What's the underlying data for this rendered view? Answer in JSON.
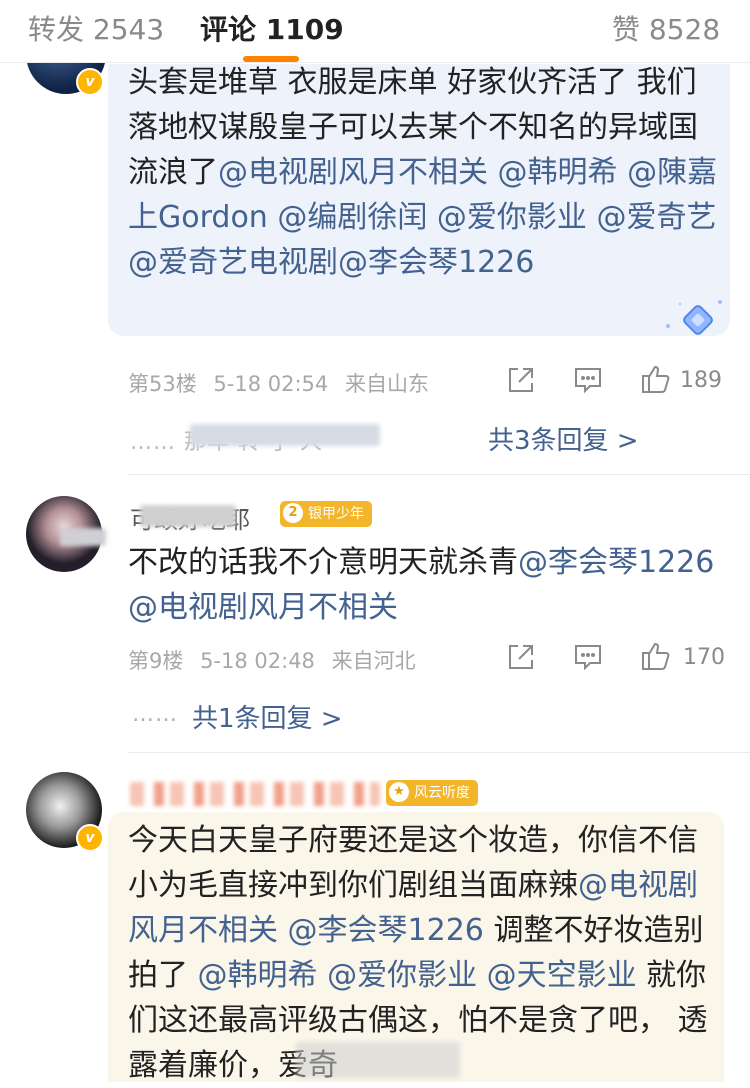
{
  "tabs": {
    "repost": "转发 2543",
    "comments": "评论 1109",
    "likes": "赞 8528"
  },
  "comment1": {
    "segments": [
      {
        "text": "头套是堆草 衣服是床单 好家伙齐活了 我们落地权谋殷皇子可以去某个不知名的异域国流浪了",
        "mention": false
      },
      {
        "text": "@电视剧风月不相关",
        "mention": true
      },
      {
        "text": " ",
        "mention": false
      },
      {
        "text": "@韩明希",
        "mention": true
      },
      {
        "text": " ",
        "mention": false
      },
      {
        "text": "@陳嘉上Gordon",
        "mention": true
      },
      {
        "text": " ",
        "mention": false
      },
      {
        "text": "@编剧徐闰",
        "mention": true
      },
      {
        "text": " ",
        "mention": false
      },
      {
        "text": "@爱你影业",
        "mention": true
      },
      {
        "text": " ",
        "mention": false
      },
      {
        "text": "@爱奇艺",
        "mention": true
      },
      {
        "text": " ",
        "mention": false
      },
      {
        "text": "@爱奇艺电视剧",
        "mention": true
      },
      {
        "text": "@李会琴1226",
        "mention": true
      }
    ],
    "floor": "第53楼",
    "date": "5-18 02:54",
    "location": "来自山东",
    "likes": "189",
    "reply_preview": "…… 那年 转 了 人",
    "reply_link": "共3条回复 >"
  },
  "comment2": {
    "username": "可颂好吃耶",
    "badge_level": "2",
    "badge_text": "银甲少年",
    "segments": [
      {
        "text": "不改的话我不介意明天就杀青",
        "mention": false
      },
      {
        "text": "@李会琴1226",
        "mention": true
      },
      {
        "text": " ",
        "mention": false
      },
      {
        "text": "@电视剧风月不相关",
        "mention": true
      }
    ],
    "floor": "第9楼",
    "date": "5-18 02:48",
    "location": "来自河北",
    "likes": "170",
    "reply_dots": "……",
    "reply_link": "共1条回复 >"
  },
  "comment3": {
    "badge_text": "风云听度",
    "segments": [
      {
        "text": "今天白天皇子府要还是这个妆造，你信不信小为毛直接冲到你们剧组当面麻辣",
        "mention": false
      },
      {
        "text": "@电视剧风月不相关",
        "mention": true
      },
      {
        "text": " ",
        "mention": false
      },
      {
        "text": "@李会琴1226",
        "mention": true
      },
      {
        "text": " 调整不好妆造别拍了 ",
        "mention": false
      },
      {
        "text": "@韩明希",
        "mention": true
      },
      {
        "text": " ",
        "mention": false
      },
      {
        "text": "@爱你影业",
        "mention": true
      },
      {
        "text": " ",
        "mention": false
      },
      {
        "text": "@天空影业",
        "mention": true
      },
      {
        "text": " 就你们这还最高评级古偶这，怕不是贪了吧， 透露着廉价，爱奇",
        "mention": false
      }
    ]
  },
  "colors": {
    "accent": "#ff8200",
    "mention": "#44628f",
    "vip_badge": "#ffb400",
    "highlight_bg1": "#eef2fb",
    "highlight_bg3": "#faf6ea"
  },
  "icons": {
    "verified": "v",
    "share": "share-icon",
    "comment": "comment-icon",
    "like": "thumbs-up-icon"
  }
}
